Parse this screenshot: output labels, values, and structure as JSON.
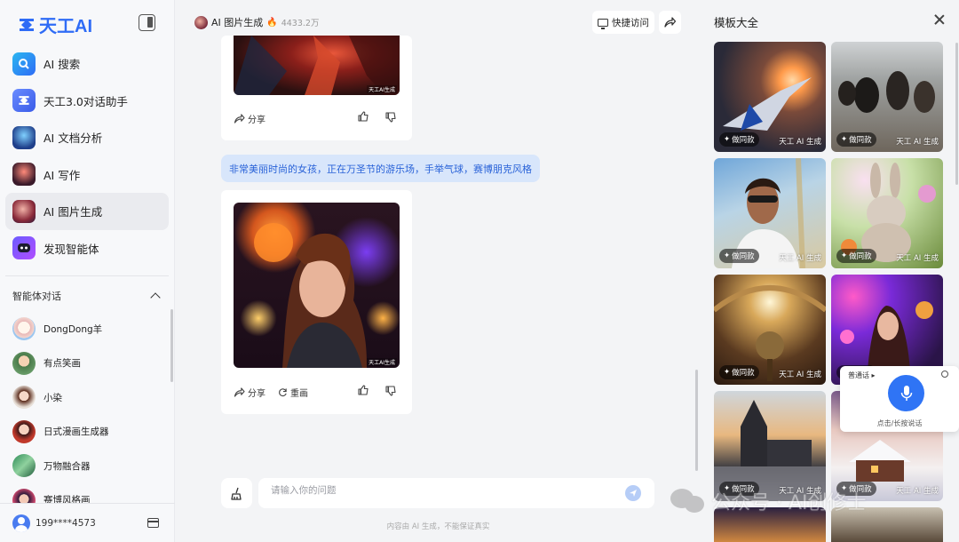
{
  "app": {
    "logo_text": "天工AI"
  },
  "sidebar": {
    "nav": [
      {
        "label": "AI 搜索"
      },
      {
        "label": "天工3.0对话助手"
      },
      {
        "label": "AI 文档分析"
      },
      {
        "label": "AI 写作"
      },
      {
        "label": "AI 图片生成",
        "active": true
      },
      {
        "label": "发现智能体"
      }
    ],
    "agents_title": "智能体对话",
    "agents": [
      {
        "name": "DongDong羊"
      },
      {
        "name": "有点笑画"
      },
      {
        "name": "小染"
      },
      {
        "name": "日式漫画生成器"
      },
      {
        "name": "万物融合器"
      },
      {
        "name": "赛博风格画"
      }
    ],
    "user_name": "199****4573"
  },
  "chat": {
    "title": "AI 图片生成",
    "heat": "4433.2万",
    "quick_access_label": "快捷访问",
    "image_watermark": "天工AI生成",
    "share_label": "分享",
    "redraw_label": "重画",
    "user_message": "非常美丽时尚的女孩，正在万圣节的游乐场，手举气球，赛博朋克风格",
    "input_placeholder": "请输入你的问题",
    "footer_note": "内容由 AI 生成，不能保证真实"
  },
  "panel": {
    "title": "模板大全",
    "use_label": "做同款",
    "watermark": "天工 AI 生成"
  },
  "voice": {
    "mode": "普通话",
    "hint": "点击/长按说话"
  },
  "overlay": {
    "watermark_text": "公众号 · AI创修士"
  },
  "colors": {
    "brand": "#2f6cf6",
    "user_bubble": "#d8e6fb",
    "user_bubble_text": "#2962d8",
    "mic": "#2f74f5"
  }
}
